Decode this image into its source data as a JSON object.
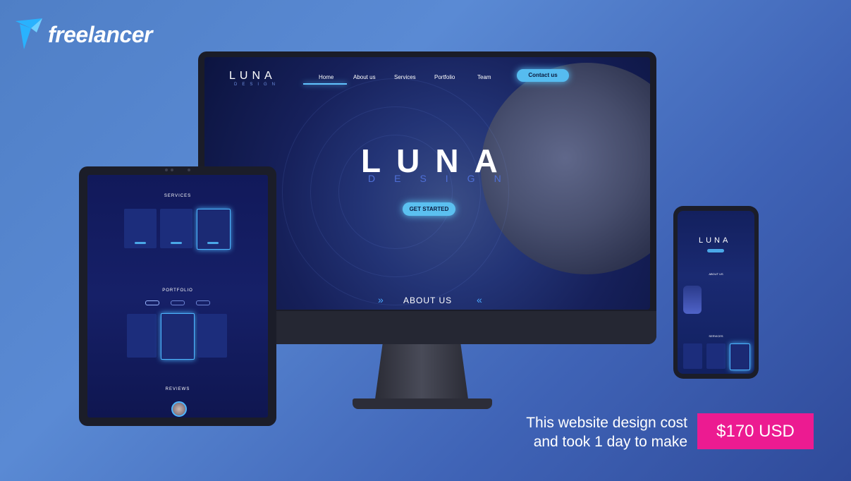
{
  "brand": {
    "logo_text": "freelancer"
  },
  "site": {
    "brand_name": "LUNA",
    "brand_sub": "DESIGN",
    "nav": [
      "Home",
      "About us",
      "Services",
      "Portfolio",
      "Team"
    ],
    "contact": "Contact us",
    "hero_title": "LUNA",
    "hero_sub": "DESIGN",
    "cta": "GET STARTED",
    "about_heading": "ABOUT US"
  },
  "tablet": {
    "services_heading": "SERVICES",
    "portfolio_heading": "PORTFOLIO",
    "reviews_heading": "REVIEWS"
  },
  "phone": {
    "brand_name": "LUNA",
    "about_heading": "ABOUT US",
    "services_heading": "SERVICES"
  },
  "promo": {
    "line1": "This website design cost",
    "line2": "and took 1 day to make",
    "price": "$170 USD"
  },
  "colors": {
    "accent": "#56bcf0",
    "price_bg": "#ec1b91",
    "bg": "#4f7fc6"
  }
}
